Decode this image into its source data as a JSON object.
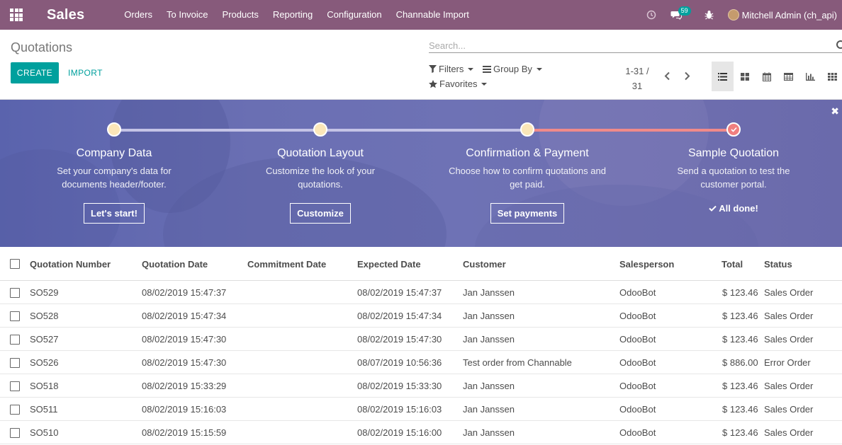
{
  "navbar": {
    "app_name": "Sales",
    "menu": [
      "Orders",
      "To Invoice",
      "Products",
      "Reporting",
      "Configuration",
      "Channable Import"
    ],
    "messages_badge": "59",
    "user": "Mitchell Admin (ch_api)",
    "color": "#875a7b"
  },
  "control_panel": {
    "title": "Quotations",
    "create_label": "CREATE",
    "import_label": "IMPORT",
    "search_placeholder": "Search...",
    "filters_label": "Filters",
    "groupby_label": "Group By",
    "favorites_label": "Favorites",
    "pager_range": "1-31 /",
    "pager_total": "31",
    "views": [
      "list",
      "kanban",
      "calendar",
      "pivot",
      "graph",
      "grid"
    ],
    "accent": "#00a09d"
  },
  "onboarding": {
    "steps": [
      {
        "title": "Company Data",
        "desc": "Set your company's data for documents header/footer.",
        "button": "Let's start!"
      },
      {
        "title": "Quotation Layout",
        "desc": "Customize the look of your quotations.",
        "button": "Customize"
      },
      {
        "title": "Confirmation & Payment",
        "desc": "Choose how to confirm quotations and get paid.",
        "button": "Set payments"
      },
      {
        "title": "Sample Quotation",
        "desc": "Send a quotation to test the customer portal.",
        "done_label": "All done!"
      }
    ]
  },
  "table": {
    "columns": [
      "Quotation Number",
      "Quotation Date",
      "Commitment Date",
      "Expected Date",
      "Customer",
      "Salesperson",
      "Total",
      "Status"
    ],
    "rows": [
      {
        "number": "SO529",
        "qdate": "08/02/2019 15:47:37",
        "cdate": "",
        "edate": "08/02/2019 15:47:37",
        "customer": "Jan Janssen",
        "salesperson": "OdooBot",
        "total": "$ 123.46",
        "status": "Sales Order"
      },
      {
        "number": "SO528",
        "qdate": "08/02/2019 15:47:34",
        "cdate": "",
        "edate": "08/02/2019 15:47:34",
        "customer": "Jan Janssen",
        "salesperson": "OdooBot",
        "total": "$ 123.46",
        "status": "Sales Order"
      },
      {
        "number": "SO527",
        "qdate": "08/02/2019 15:47:30",
        "cdate": "",
        "edate": "08/02/2019 15:47:30",
        "customer": "Jan Janssen",
        "salesperson": "OdooBot",
        "total": "$ 123.46",
        "status": "Sales Order"
      },
      {
        "number": "SO526",
        "qdate": "08/02/2019 15:47:30",
        "cdate": "",
        "edate": "08/07/2019 10:56:36",
        "customer": "Test order from Channable",
        "salesperson": "OdooBot",
        "total": "$ 886.00",
        "status": "Error Order"
      },
      {
        "number": "SO518",
        "qdate": "08/02/2019 15:33:29",
        "cdate": "",
        "edate": "08/02/2019 15:33:30",
        "customer": "Jan Janssen",
        "salesperson": "OdooBot",
        "total": "$ 123.46",
        "status": "Sales Order"
      },
      {
        "number": "SO511",
        "qdate": "08/02/2019 15:16:03",
        "cdate": "",
        "edate": "08/02/2019 15:16:03",
        "customer": "Jan Janssen",
        "salesperson": "OdooBot",
        "total": "$ 123.46",
        "status": "Sales Order"
      },
      {
        "number": "SO510",
        "qdate": "08/02/2019 15:15:59",
        "cdate": "",
        "edate": "08/02/2019 15:16:00",
        "customer": "Jan Janssen",
        "salesperson": "OdooBot",
        "total": "$ 123.46",
        "status": "Sales Order"
      }
    ]
  }
}
